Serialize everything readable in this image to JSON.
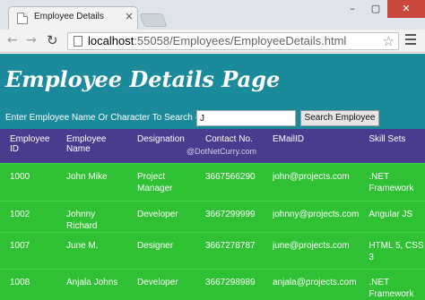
{
  "browser": {
    "tab_title": "Employee Details",
    "tab_close": "×",
    "url_host": "localhost",
    "url_path": ":55058/Employees/EmployeeDetails.html",
    "window_buttons": [
      "–",
      "▢",
      "✕"
    ]
  },
  "page": {
    "title": "Employee Details Page",
    "search": {
      "label": "Enter Employee Name Or Character To Search -",
      "value": "J",
      "button_label": "Search Employee"
    },
    "watermark": "@DotNetCurry.com",
    "table": {
      "headers": [
        "Employee ID",
        "Employee Name",
        "Designation",
        "Contact No.",
        "EMailID",
        "Skill Sets"
      ],
      "rows": [
        [
          "1000",
          "John Mike",
          "Project Manager",
          "3667566290",
          "john@projects.com",
          ".NET Framework"
        ],
        [
          "1002",
          "Johnny Richard",
          "Developer",
          "3667299999",
          "johnny@projects.com",
          "Angular JS"
        ],
        [
          "1007",
          "June M.",
          "Designer",
          "3667278787",
          "june@projects.com",
          "HTML 5, CSS 3"
        ],
        [
          "1008",
          "Anjala Johns",
          "Developer",
          "3667298989",
          "anjala@projects.com",
          ".NET Framework"
        ]
      ]
    }
  },
  "colors": {
    "header_band": "#1b8a9b",
    "table_header": "#4a3b8e",
    "table_row": "#2fc033",
    "close_button": "#c9463d"
  },
  "icons": [
    "back-arrow-icon",
    "forward-arrow-icon",
    "reload-icon",
    "page-icon",
    "star-icon",
    "menu-icon",
    "favicon-icon"
  ]
}
